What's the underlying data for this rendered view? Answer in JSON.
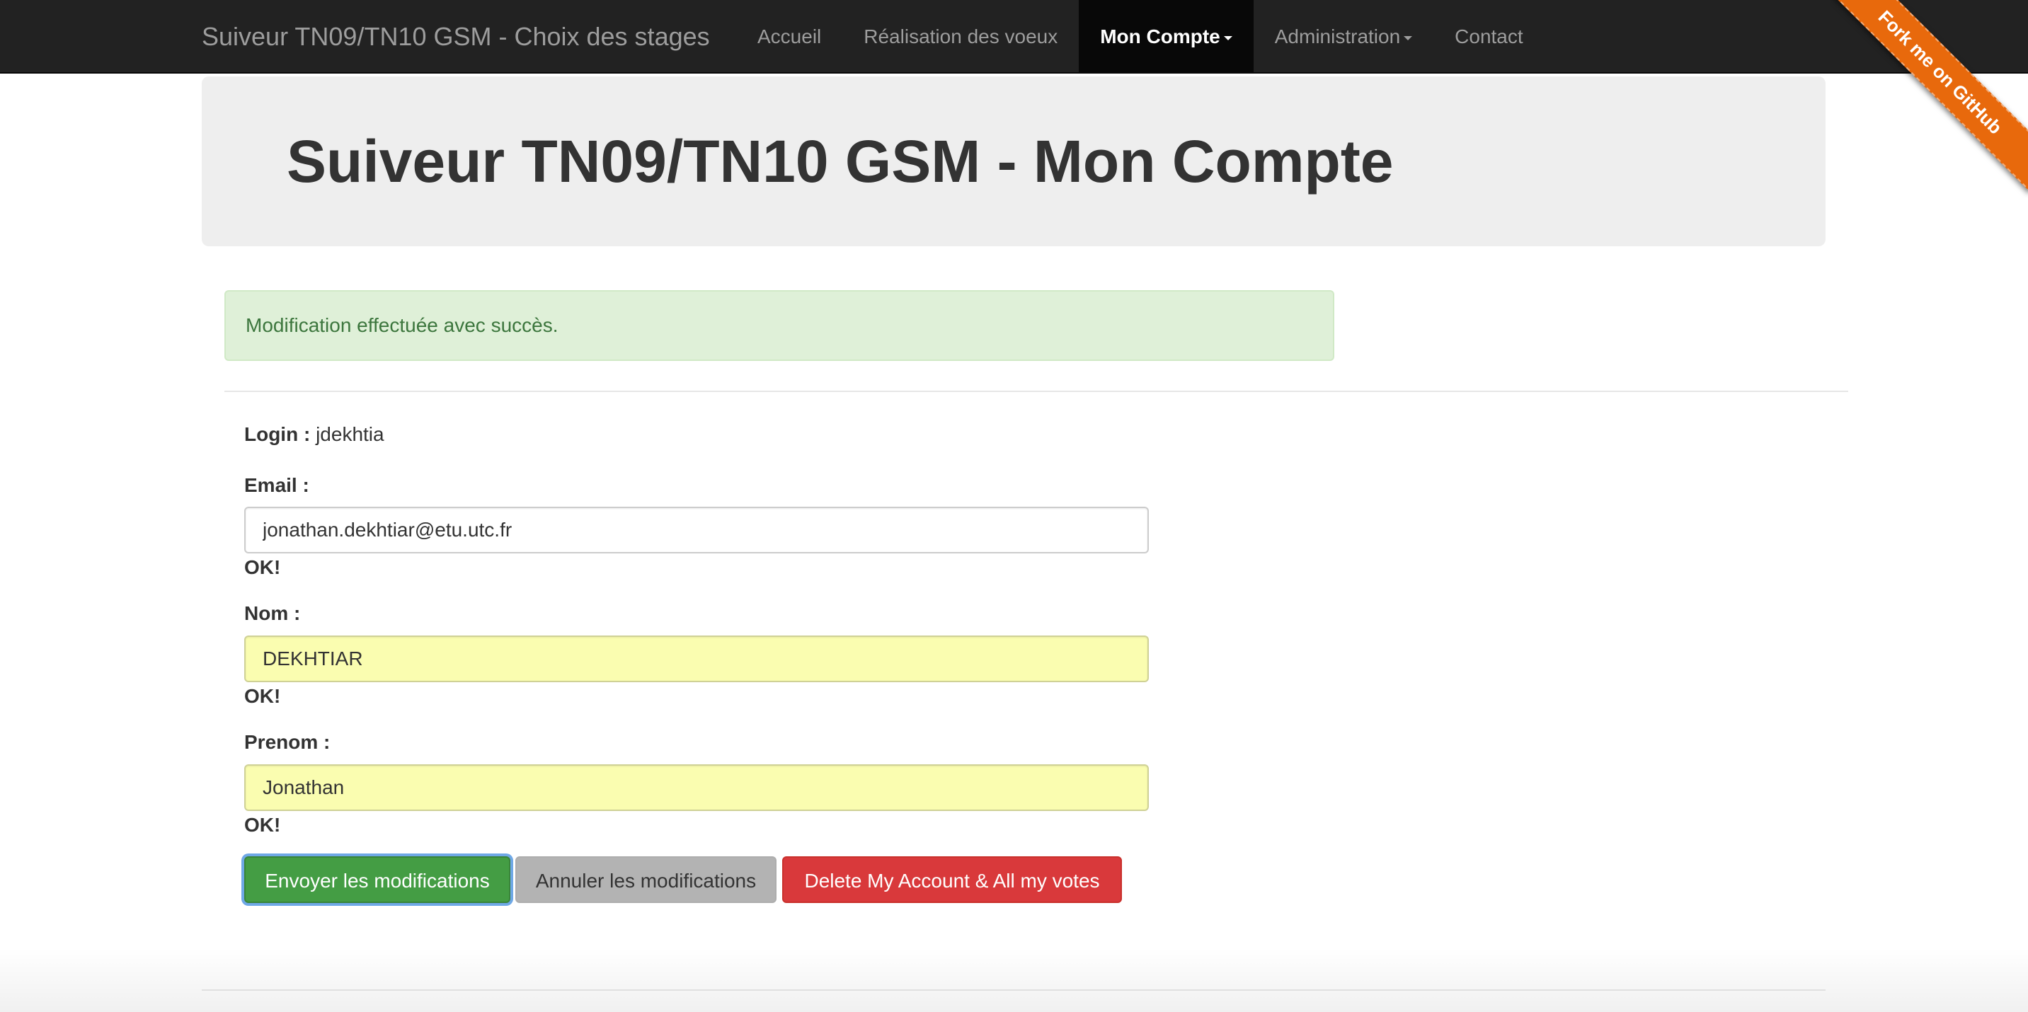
{
  "navbar": {
    "brand": "Suiveur TN09/TN10 GSM - Choix des stages",
    "items": [
      {
        "label": "Accueil",
        "active": false,
        "dropdown": false
      },
      {
        "label": "Réalisation des voeux",
        "active": false,
        "dropdown": false
      },
      {
        "label": "Mon Compte",
        "active": true,
        "dropdown": true
      },
      {
        "label": "Administration",
        "active": false,
        "dropdown": true
      },
      {
        "label": "Contact",
        "active": false,
        "dropdown": false
      }
    ]
  },
  "ribbon": {
    "label": "Fork me on GitHub",
    "color": "#e8690c"
  },
  "jumbotron": {
    "title": "Suiveur TN09/TN10 GSM - Mon Compte"
  },
  "alert": {
    "message": "Modification effectuée avec succès.",
    "color": "#3c763d",
    "background": "#dff0d8"
  },
  "account": {
    "login_label": "Login :",
    "login_value": "jdekhtia",
    "email": {
      "label": "Email :",
      "value": "jonathan.dekhtiar@etu.utc.fr",
      "status": "OK!"
    },
    "nom": {
      "label": "Nom :",
      "value": "DEKHTIAR",
      "status": "OK!"
    },
    "prenom": {
      "label": "Prenom :",
      "value": "Jonathan",
      "status": "OK!"
    }
  },
  "actions": {
    "submit_label": "Envoyer les modifications",
    "cancel_label": "Annuler les modifications",
    "delete_label": "Delete My Account & All my votes",
    "submit_color": "#449d44",
    "delete_color": "#d9393b"
  }
}
